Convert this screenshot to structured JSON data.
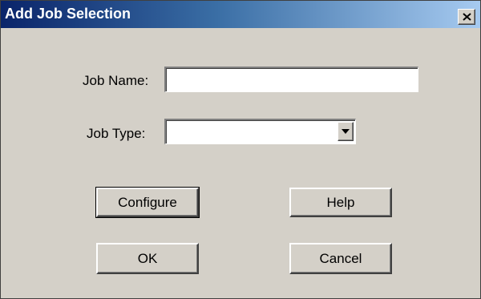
{
  "window": {
    "title": "Add Job Selection",
    "close_glyph": "✕",
    "close_icon": "close-icon"
  },
  "form": {
    "job_name_label": "Job Name:",
    "job_name_value": "",
    "job_type_label": "Job Type:",
    "job_type_value": ""
  },
  "buttons": {
    "configure": "Configure",
    "help": "Help",
    "ok": "OK",
    "cancel": "Cancel"
  },
  "colors": {
    "title_bar_start": "#0a246a",
    "title_bar_end": "#a6caf0",
    "dialog_bg": "#d4d0c8"
  }
}
